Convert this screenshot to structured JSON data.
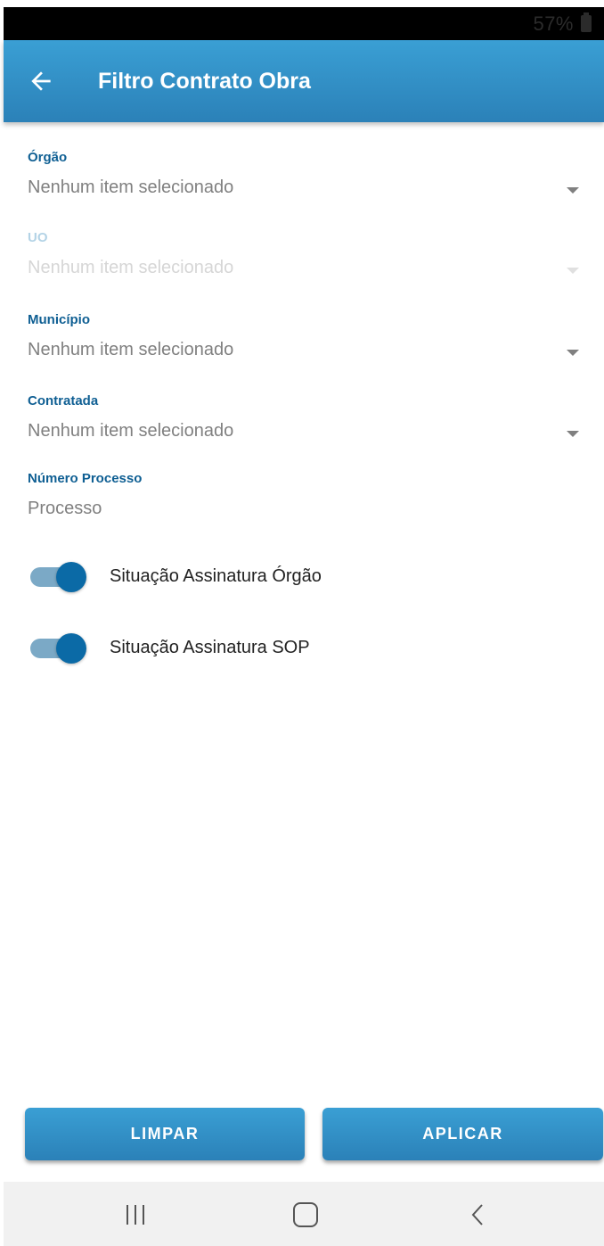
{
  "status_bar": {
    "battery": "57%"
  },
  "app_bar": {
    "title": "Filtro Contrato Obra",
    "back_icon": "arrow-left-icon"
  },
  "fields": [
    {
      "label": "Órgão",
      "value": "Nenhum item selecionado",
      "type": "dropdown",
      "enabled": true
    },
    {
      "label": "UO",
      "value": "Nenhum item selecionado",
      "type": "dropdown",
      "enabled": false
    },
    {
      "label": "Município",
      "value": "Nenhum item selecionado",
      "type": "dropdown",
      "enabled": true
    },
    {
      "label": "Contratada",
      "value": "Nenhum item selecionado",
      "type": "dropdown",
      "enabled": true
    },
    {
      "label": "Número Processo",
      "placeholder": "Processo",
      "type": "text",
      "enabled": true
    }
  ],
  "toggles": [
    {
      "label": "Situação Assinatura Órgão",
      "on": true
    },
    {
      "label": "Situação Assinatura SOP",
      "on": true
    }
  ],
  "buttons": {
    "clear": "LIMPAR",
    "apply": "APLICAR"
  },
  "nav_bar": {
    "recent_icon": "recent-apps-icon",
    "home_icon": "home-icon",
    "back_icon": "nav-back-icon"
  },
  "colors": {
    "primary": "#2b81b8",
    "label": "#0f5f93",
    "toggle_thumb": "#0b6aa6",
    "toggle_track": "#7ba9c6"
  }
}
